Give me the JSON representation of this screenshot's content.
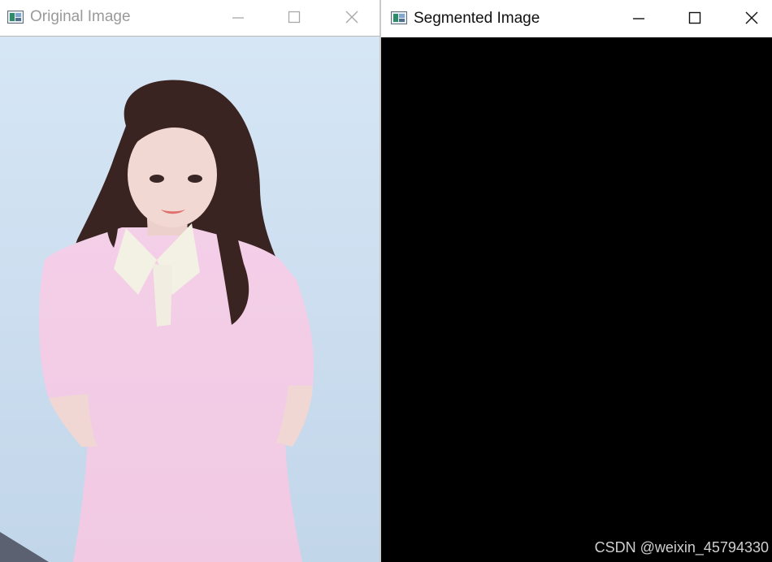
{
  "windows": {
    "original": {
      "title": "Original Image",
      "icon": "app-image-icon",
      "controls": {
        "minimize": "minimize-icon",
        "maximize": "maximize-icon",
        "close": "close-icon"
      }
    },
    "segmented": {
      "title": "Segmented Image",
      "icon": "app-image-icon",
      "controls": {
        "minimize": "minimize-icon",
        "maximize": "maximize-icon",
        "close": "close-icon"
      }
    }
  },
  "watermark": "CSDN @weixin_45794330",
  "colors": {
    "photo_background": "#cfe0f1",
    "shirt": "#f3cde6",
    "collar": "#f3f0e4",
    "hair": "#3a2422",
    "skin": "#f1d8d2",
    "segmented_canvas": "#000000"
  }
}
